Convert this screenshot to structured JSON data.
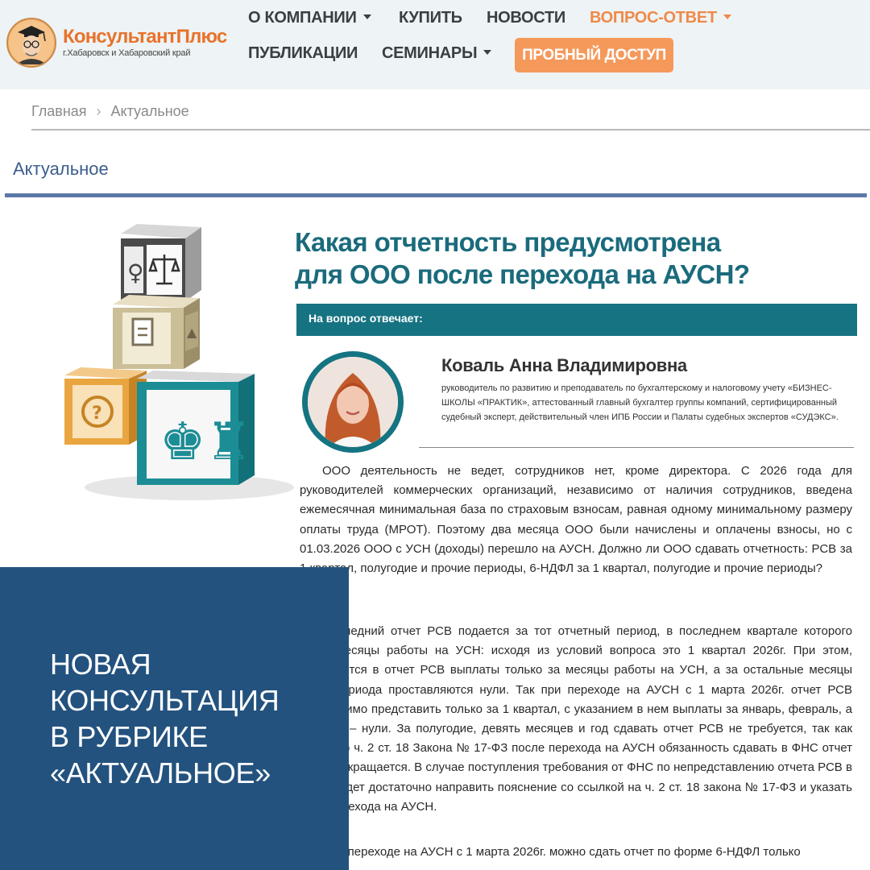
{
  "brand": {
    "name": "КонсультантПлюс",
    "region": "г.Хабаровск и Хабаровский край"
  },
  "nav": {
    "items": [
      {
        "label": "О КОМПАНИИ",
        "has_dropdown": true
      },
      {
        "label": "КУПИТЬ"
      },
      {
        "label": "НОВОСТИ"
      },
      {
        "label": "ВОПРОС-ОТВЕТ",
        "has_dropdown": true,
        "active": true
      },
      {
        "label": "ПУБЛИКАЦИИ"
      },
      {
        "label": "СЕМИНАРЫ",
        "has_dropdown": true
      }
    ],
    "cta_label": "ПРОБНЫЙ ДОСТУП"
  },
  "breadcrumb": {
    "home": "Главная",
    "separator": "›",
    "current": "Актуальное"
  },
  "section_title": "Актуальное",
  "article": {
    "title_line1": "Какая отчетность предусмотрена",
    "title_line2": "для ООО после перехода на АУСН?",
    "answer_label": "На вопрос отвечает:",
    "expert_name": "Коваль Анна Владимировна",
    "expert_bio": "руководитель по развитию и преподаватель по бухгалтерскому и налоговому учету «БИЗНЕС-ШКОЛЫ «ПРАКТИК», аттестованный главный бухгалтер группы компаний, сертифицированный судебный эксперт, действительный член ИПБ России и Палаты судебных экспертов «СУДЭКС».",
    "paragraph1": "ООО деятельность не ведет, сотрудников нет, кроме директора. С 2026 года для руководителей коммерческих организаций, независимо от наличия сотрудников, введена ежемесячная минимальная база по страховым взносам, равная одному минимальному размеру оплаты труда (МРОТ). Поэтому два месяца ООО были начислены и оплачены взносы, но с 01.03.2026 ООО с УСН (доходы) перешло на АУСН. Должно ли ООО сдавать отчетность: РСВ за 1 квартал, полугодие и прочие периоды, 6-НДФЛ за 1 квартал, полугодие и прочие периоды?",
    "paragraph2": "Последний отчет РСВ подается за тот отчетный период, в последнем квартале которого были месяцы работы на УСН: исходя из условий вопроса это 1 квартал 2026г. При этом, включаются в отчет РСВ выплаты только за месяцы работы на УСН, а за остальные месяцы этого периода проставляются нули. Так при переходе на АУСН с 1 марта 2026г. отчет РСВ необходимо представить только за 1 квартал, с указанием в нем выплаты за январь, февраль, а за март – нули. За полугодие, девять месяцев и год сдавать отчет РСВ не требуется, так как согласно ч. 2 ст. 18 Закона № 17-ФЗ после перехода на АУСН обязанность сдавать в ФНС отчет РСВ прекращается. В случае поступления требования от ФНС по непредставлению отчета РСВ в ответ будет достаточно направить пояснение со ссылкой на ч. 2 ст. 18 закона № 17-ФЗ и указать дату перехода на АУСН.",
    "paragraph3": "При переходе на АУСН с 1 марта 2026г. можно сдать отчет по форме 6-НДФЛ только"
  },
  "overlay": {
    "line1": "НОВАЯ",
    "line2": "КОНСУЛЬТАЦИЯ",
    "line3": "В РУБРИКЕ",
    "line4": "«АКТУАЛЬНОЕ»"
  },
  "icons": {
    "logo": "professor-mascot-icon",
    "cubes": "knowledge-cubes-illustration"
  },
  "colors": {
    "brand_orange": "#e8722a",
    "cta": "#f5995b",
    "teal": "#167382",
    "title_teal": "#1a6b7c",
    "overlay_blue": "#23527e",
    "section_blue": "#3b5e8c"
  }
}
